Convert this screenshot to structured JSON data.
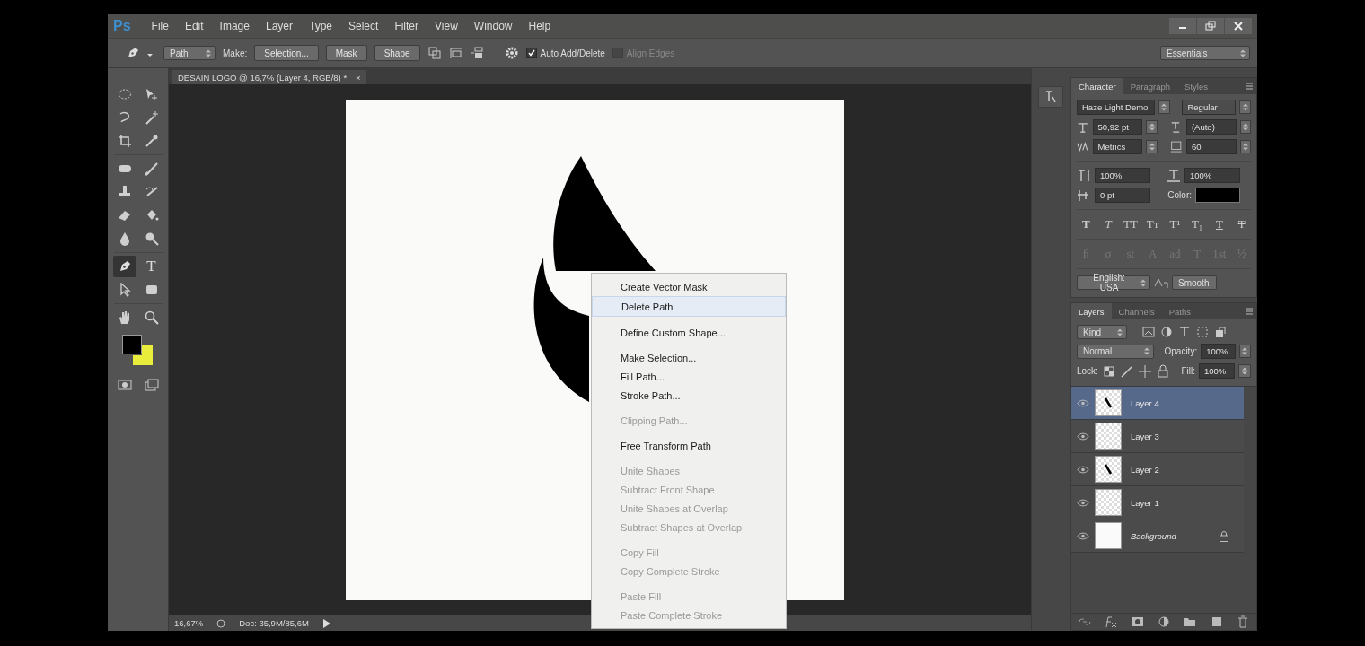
{
  "app": {
    "logo": "Ps"
  },
  "menu": [
    "File",
    "Edit",
    "Image",
    "Layer",
    "Type",
    "Select",
    "Filter",
    "View",
    "Window",
    "Help"
  ],
  "options_bar": {
    "mode": "Path",
    "make_label": "Make:",
    "buttons": [
      "Selection...",
      "Mask",
      "Shape"
    ],
    "auto_add_delete": {
      "label": "Auto Add/Delete",
      "checked": true
    },
    "align_edges": {
      "label": "Align Edges",
      "checked": false,
      "disabled": true
    },
    "workspace": "Essentials"
  },
  "document": {
    "tab": "DESAIN LOGO @ 16,7% (Layer 4, RGB/8) *",
    "close": "×",
    "zoom": "16,67%",
    "info": "Doc: 35,9M/85,6M"
  },
  "context_menu": [
    [
      {
        "label": "Create Vector Mask",
        "disabled": false,
        "highlighted": false
      },
      {
        "label": "Delete Path",
        "disabled": false,
        "highlighted": true
      }
    ],
    [
      {
        "label": "Define Custom Shape...",
        "disabled": false,
        "highlighted": false
      }
    ],
    [
      {
        "label": "Make Selection...",
        "disabled": false,
        "highlighted": false
      },
      {
        "label": "Fill Path...",
        "disabled": false,
        "highlighted": false
      },
      {
        "label": "Stroke Path...",
        "disabled": false,
        "highlighted": false
      }
    ],
    [
      {
        "label": "Clipping Path...",
        "disabled": true,
        "highlighted": false
      }
    ],
    [
      {
        "label": "Free Transform Path",
        "disabled": false,
        "highlighted": false
      }
    ],
    [
      {
        "label": "Unite Shapes",
        "disabled": true,
        "highlighted": false
      },
      {
        "label": "Subtract Front Shape",
        "disabled": true,
        "highlighted": false
      },
      {
        "label": "Unite Shapes at Overlap",
        "disabled": true,
        "highlighted": false
      },
      {
        "label": "Subtract Shapes at Overlap",
        "disabled": true,
        "highlighted": false
      }
    ],
    [
      {
        "label": "Copy Fill",
        "disabled": true,
        "highlighted": false
      },
      {
        "label": "Copy Complete Stroke",
        "disabled": true,
        "highlighted": false
      }
    ],
    [
      {
        "label": "Paste Fill",
        "disabled": true,
        "highlighted": false
      },
      {
        "label": "Paste Complete Stroke",
        "disabled": true,
        "highlighted": false
      }
    ]
  ],
  "toolbox": {
    "rows": [
      [
        {
          "kind": "ellipse-marquee",
          "selected": false
        },
        {
          "kind": "move",
          "selected": false
        }
      ],
      [
        {
          "kind": "lasso",
          "selected": false
        },
        {
          "kind": "magic-wand",
          "selected": false
        }
      ],
      [
        {
          "kind": "crop",
          "selected": false
        },
        {
          "kind": "eyedropper",
          "selected": false
        }
      ],
      [
        {
          "kind": "healing",
          "selected": false
        },
        {
          "kind": "brush",
          "selected": false
        }
      ],
      [
        {
          "kind": "stamp",
          "selected": false
        },
        {
          "kind": "history-brush",
          "selected": false
        }
      ],
      [
        {
          "kind": "eraser",
          "selected": false
        },
        {
          "kind": "bucket",
          "selected": false
        }
      ],
      [
        {
          "kind": "blur",
          "selected": false
        },
        {
          "kind": "dodge",
          "selected": false
        }
      ],
      [
        {
          "kind": "pen",
          "selected": true
        },
        {
          "kind": "type",
          "selected": false,
          "label": "T"
        }
      ],
      [
        {
          "kind": "path-select",
          "selected": false
        },
        {
          "kind": "rectangle",
          "selected": false
        }
      ],
      [
        {
          "kind": "hand",
          "selected": false
        },
        {
          "kind": "zoom",
          "selected": false
        }
      ]
    ]
  },
  "character_panel": {
    "tabs": [
      {
        "label": "Character",
        "selected": true
      },
      {
        "label": "Paragraph",
        "selected": false
      },
      {
        "label": "Styles",
        "selected": false
      }
    ],
    "font_family": "Haze Light Demo",
    "font_style": {
      "value": "Regular",
      "disabled": true
    },
    "font_size": "50,92 pt",
    "leading": "(Auto)",
    "kerning": "Metrics",
    "tracking": "60",
    "vertical_scale": "100%",
    "horizontal_scale": "100%",
    "baseline_shift": "0 pt",
    "color_label": "Color:",
    "style_buttons": [
      {
        "label": "T",
        "kind": "bold"
      },
      {
        "label": "T",
        "kind": "italic"
      },
      {
        "label": "TT",
        "kind": "caps"
      },
      {
        "label": "Tт",
        "kind": "small-caps"
      },
      {
        "label": "T¹",
        "kind": "superscript"
      },
      {
        "label": "T₁",
        "kind": "subscript"
      },
      {
        "label": "T",
        "kind": "underline"
      },
      {
        "label": "T",
        "kind": "strikethrough"
      }
    ],
    "opentype_buttons": {
      "disabled": true,
      "labels": [
        "ﬁ",
        "σ",
        "st",
        "A",
        "ad",
        "T",
        "1st",
        "½"
      ]
    },
    "language": "English: USA",
    "antialias": "Smooth"
  },
  "layers_panel": {
    "tabs": [
      {
        "label": "Layers",
        "selected": true
      },
      {
        "label": "Channels",
        "selected": false
      },
      {
        "label": "Paths",
        "selected": false
      }
    ],
    "filter": "Kind",
    "blend_mode": "Normal",
    "opacity_label": "Opacity:",
    "opacity": "100%",
    "lock_label": "Lock:",
    "fill_label": "Fill:",
    "fill": "100%",
    "layers": [
      {
        "name": "Layer 4",
        "kind": "layer",
        "transparent": true,
        "has_stroke": true,
        "selected": true,
        "visible": true,
        "locked": false
      },
      {
        "name": "Layer 3",
        "kind": "layer",
        "transparent": true,
        "has_stroke": false,
        "selected": false,
        "visible": true,
        "locked": false
      },
      {
        "name": "Layer 2",
        "kind": "layer",
        "transparent": true,
        "has_stroke": true,
        "selected": false,
        "visible": true,
        "locked": false
      },
      {
        "name": "Layer 1",
        "kind": "layer",
        "transparent": true,
        "has_stroke": false,
        "selected": false,
        "visible": true,
        "locked": false
      },
      {
        "name": "Background",
        "kind": "background",
        "transparent": false,
        "has_stroke": false,
        "selected": false,
        "visible": true,
        "locked": true
      }
    ]
  }
}
